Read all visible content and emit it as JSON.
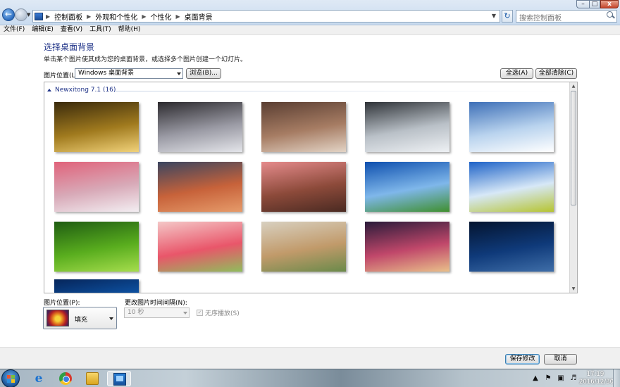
{
  "window": {
    "breadcrumb": [
      "控制面板",
      "外观和个性化",
      "个性化",
      "桌面背景"
    ],
    "search_placeholder": "搜索控制面板",
    "controls": {
      "minimize": "–",
      "maximize": "□",
      "close": "x"
    }
  },
  "menubar": {
    "items": [
      "文件(F)",
      "编辑(E)",
      "查看(V)",
      "工具(T)",
      "帮助(H)"
    ]
  },
  "content": {
    "title": "选择桌面背景",
    "description": "单击某个图片使其成为您的桌面背景，或选择多个图片创建一个幻灯片。",
    "picture_location_label": "图片位置(L):",
    "picture_location_value": "Windows 桌面背景",
    "browse_button": "浏览(B)...",
    "select_all_button": "全选(A)",
    "clear_all_button": "全部清除(C)"
  },
  "gallery": {
    "group_title": "Newxitong 7.1 (16)",
    "thumbnails": [
      {
        "name": "clock-2017",
        "colors": [
          "#3a2a0c",
          "#a07a1e",
          "#f1d27a"
        ]
      },
      {
        "name": "snow-train-station",
        "colors": [
          "#2c2a2e",
          "#9a9aa4",
          "#e4e5ea"
        ]
      },
      {
        "name": "girl-in-snow",
        "colors": [
          "#5a3e32",
          "#a67c63",
          "#e3d4c6"
        ]
      },
      {
        "name": "snowy-fence",
        "colors": [
          "#2f3338",
          "#b9c0c7",
          "#eef1f4"
        ]
      },
      {
        "name": "snowy-road",
        "colors": [
          "#3d6fb7",
          "#b9d3ee",
          "#ffffff"
        ]
      },
      {
        "name": "winter-sunset-cabin",
        "colors": [
          "#e0627a",
          "#d8aab8",
          "#f3eef2"
        ]
      },
      {
        "name": "mountain-sunrise",
        "colors": [
          "#3a4560",
          "#c7623a",
          "#e69b6a"
        ]
      },
      {
        "name": "red-rock-mountains",
        "colors": [
          "#e58b8c",
          "#8c4a3a",
          "#4a2a22"
        ]
      },
      {
        "name": "blue-sky-clouds",
        "colors": [
          "#0e4fae",
          "#7fb7ea",
          "#3f8f2e"
        ]
      },
      {
        "name": "sky-yellow-field",
        "colors": [
          "#1d62c7",
          "#d7e8f7",
          "#b6c431"
        ]
      },
      {
        "name": "green-leaves",
        "colors": [
          "#1f5c12",
          "#59ad1e",
          "#a6dd4d"
        ]
      },
      {
        "name": "tulips",
        "colors": [
          "#f4c7c7",
          "#e9566a",
          "#8fbd5c"
        ]
      },
      {
        "name": "girl-with-scarf",
        "colors": [
          "#d8d0c0",
          "#c19a6a",
          "#6a8a4a"
        ]
      },
      {
        "name": "coffee-bokeh",
        "colors": [
          "#2a1b3a",
          "#c0476a",
          "#e9c08a"
        ]
      },
      {
        "name": "night-lamps",
        "colors": [
          "#04142f",
          "#0f3a7a",
          "#3f6ea8"
        ]
      },
      {
        "name": "blue-partial",
        "colors": [
          "#06255a",
          "#0f5cb3",
          "#1f79d1"
        ]
      }
    ]
  },
  "options": {
    "position_label": "图片位置(P):",
    "position_value": "填充",
    "interval_label": "更改图片时间间隔(N):",
    "interval_value": "10 秒",
    "shuffle_label": "无序播放(S)",
    "shuffle_checked": true,
    "shuffle_enabled": false
  },
  "footer": {
    "save_button": "保存修改",
    "cancel_button": "取消"
  },
  "taskbar": {
    "apps": [
      "internet-explorer",
      "chrome",
      "windows-explorer",
      "control-panel"
    ],
    "active_app": "control-panel",
    "time": "17:19",
    "date": "2016/12/30"
  }
}
